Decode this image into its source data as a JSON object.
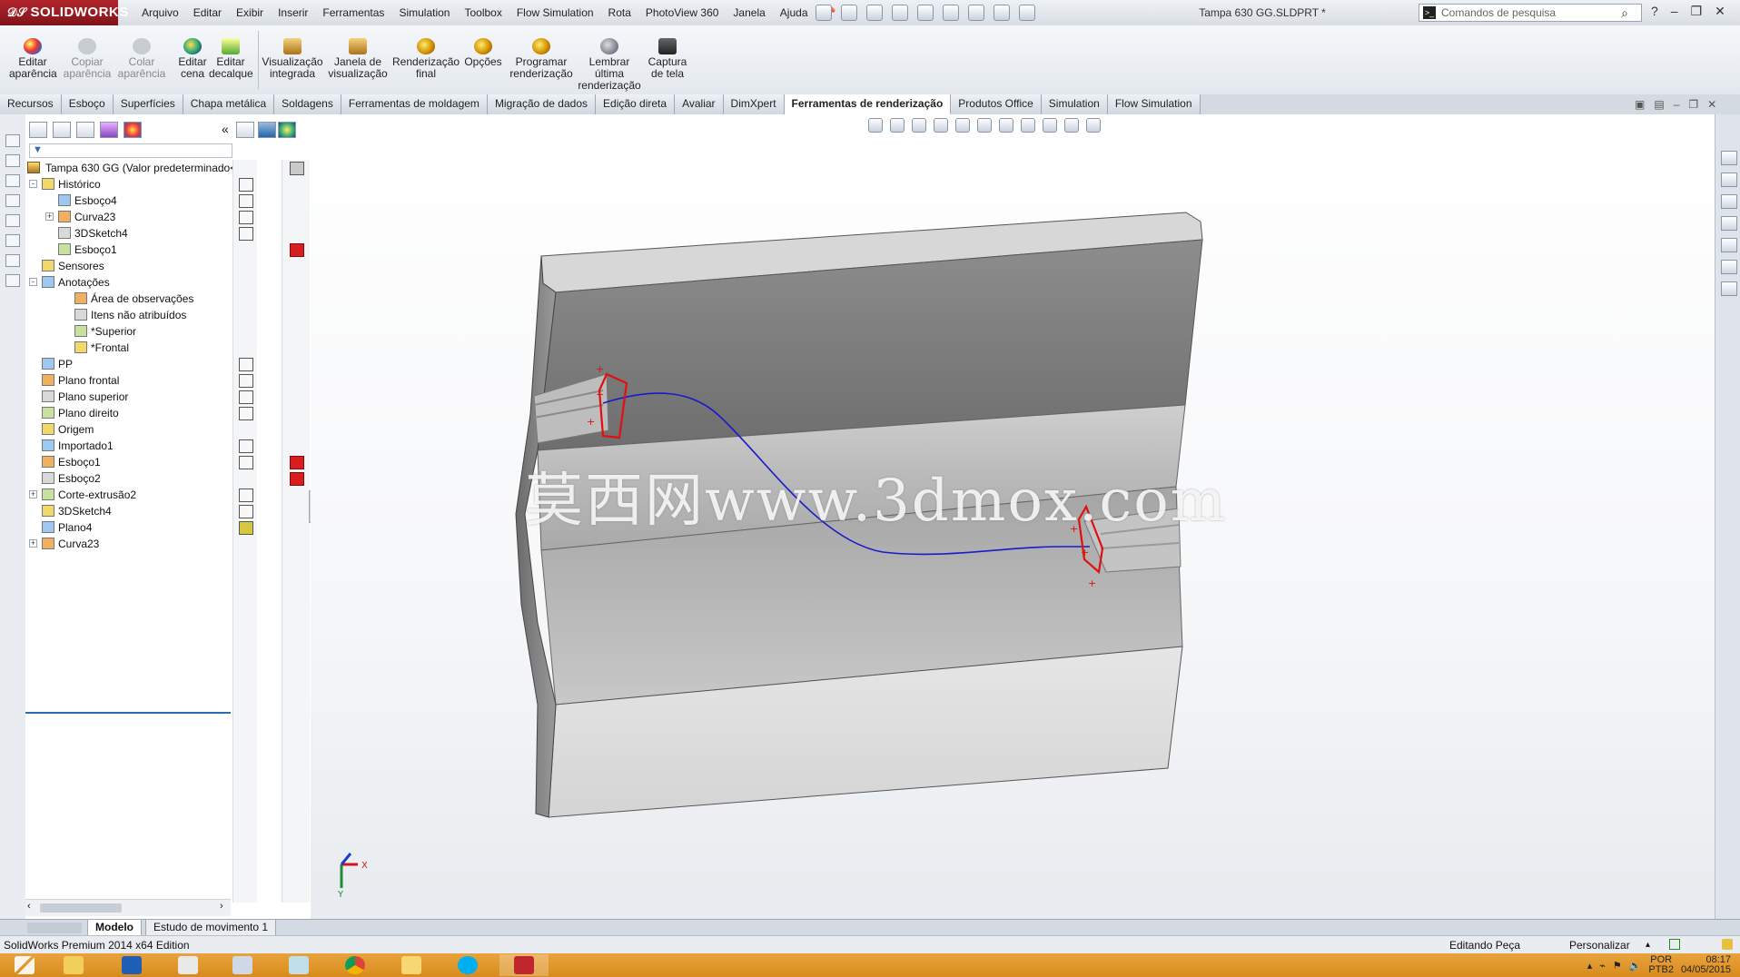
{
  "app": {
    "brand": "SOLIDWORKS",
    "document_title": "Tampa 630 GG.SLDPRT *",
    "search_placeholder": "Comandos de pesquisa",
    "edition": "SolidWorks Premium 2014 x64 Edition"
  },
  "menu": [
    "Arquivo",
    "Editar",
    "Exibir",
    "Inserir",
    "Ferramentas",
    "Simulation",
    "Toolbox",
    "Flow Simulation",
    "Rota",
    "PhotoView 360",
    "Janela",
    "Ajuda"
  ],
  "ribbon": {
    "buttons": [
      {
        "label": "Editar\naparência",
        "enabled": true,
        "icon": "appearance-icon"
      },
      {
        "label": "Copiar\naparência",
        "enabled": false,
        "icon": "copy-appearance-icon"
      },
      {
        "label": "Colar\naparência",
        "enabled": false,
        "icon": "paste-appearance-icon"
      },
      {
        "label": "Editar\ncena",
        "enabled": true,
        "icon": "scene-icon"
      },
      {
        "label": "Editar\ndecalque",
        "enabled": true,
        "icon": "decal-icon"
      },
      {
        "label": "Visualização\nintegrada",
        "enabled": true,
        "icon": "integrated-preview-icon"
      },
      {
        "label": "Janela de\nvisualização",
        "enabled": true,
        "icon": "preview-window-icon"
      },
      {
        "label": "Renderização\nfinal",
        "enabled": true,
        "icon": "final-render-icon"
      },
      {
        "label": "Opções",
        "enabled": true,
        "icon": "options-icon"
      },
      {
        "label": "Programar\nrenderização",
        "enabled": true,
        "icon": "schedule-render-icon"
      },
      {
        "label": "Lembrar\núltima\nrenderização",
        "enabled": true,
        "icon": "recall-render-icon"
      },
      {
        "label": "Captura\nde tela",
        "enabled": true,
        "icon": "screenshot-icon"
      }
    ]
  },
  "tabs": [
    "Recursos",
    "Esboço",
    "Superfícies",
    "Chapa metálica",
    "Soldagens",
    "Ferramentas de moldagem",
    "Migração de dados",
    "Edição direta",
    "Avaliar",
    "DimXpert",
    "Ferramentas de renderização",
    "Produtos Office",
    "Simulation",
    "Flow Simulation"
  ],
  "active_tab": "Ferramentas de renderização",
  "tree": {
    "root": "Tampa 630 GG  (Valor predeterminado<",
    "items": [
      {
        "label": "Histórico",
        "level": 1,
        "expander": "-"
      },
      {
        "label": "Esboço4",
        "level": 2,
        "expander": ""
      },
      {
        "label": "Curva23",
        "level": 2,
        "expander": "+"
      },
      {
        "label": "3DSketch4",
        "level": 2,
        "expander": ""
      },
      {
        "label": "Esboço1",
        "level": 2,
        "expander": ""
      },
      {
        "label": "Sensores",
        "level": 1,
        "expander": ""
      },
      {
        "label": "Anotações",
        "level": 1,
        "expander": "-"
      },
      {
        "label": "Área de observações",
        "level": 3,
        "expander": ""
      },
      {
        "label": "Itens não atribuídos",
        "level": 3,
        "expander": ""
      },
      {
        "label": "*Superior",
        "level": 3,
        "expander": ""
      },
      {
        "label": "*Frontal",
        "level": 3,
        "expander": ""
      },
      {
        "label": "PP",
        "level": 1,
        "expander": ""
      },
      {
        "label": "Plano frontal",
        "level": 1,
        "expander": ""
      },
      {
        "label": "Plano superior",
        "level": 1,
        "expander": ""
      },
      {
        "label": "Plano direito",
        "level": 1,
        "expander": ""
      },
      {
        "label": "Origem",
        "level": 1,
        "expander": ""
      },
      {
        "label": "Importado1",
        "level": 1,
        "expander": ""
      },
      {
        "label": "Esboço1",
        "level": 1,
        "expander": ""
      },
      {
        "label": "Esboço2",
        "level": 1,
        "expander": ""
      },
      {
        "label": "Corte-extrusão2",
        "level": 1,
        "expander": "+"
      },
      {
        "label": "3DSketch4",
        "level": 1,
        "expander": ""
      },
      {
        "label": "Plano4",
        "level": 1,
        "expander": ""
      },
      {
        "label": "Curva23",
        "level": 1,
        "expander": "+"
      }
    ]
  },
  "watermark": "莫西网www.3dmox.com",
  "triad": {
    "x": "X",
    "y": "Y"
  },
  "model_tabs": [
    "Modelo",
    "Estudo de movimento 1"
  ],
  "status": {
    "editing": "Editando Peça",
    "customize": "Personalizar"
  },
  "taskbar": {
    "lang": "POR",
    "layout": "PTB2",
    "time": "08:17",
    "date": "04/05/2015"
  },
  "colors": {
    "brand_red": "#b3252d",
    "sketch_red": "#e01010",
    "curve_blue": "#1a1acc",
    "taskbar": "#e09a2c"
  }
}
